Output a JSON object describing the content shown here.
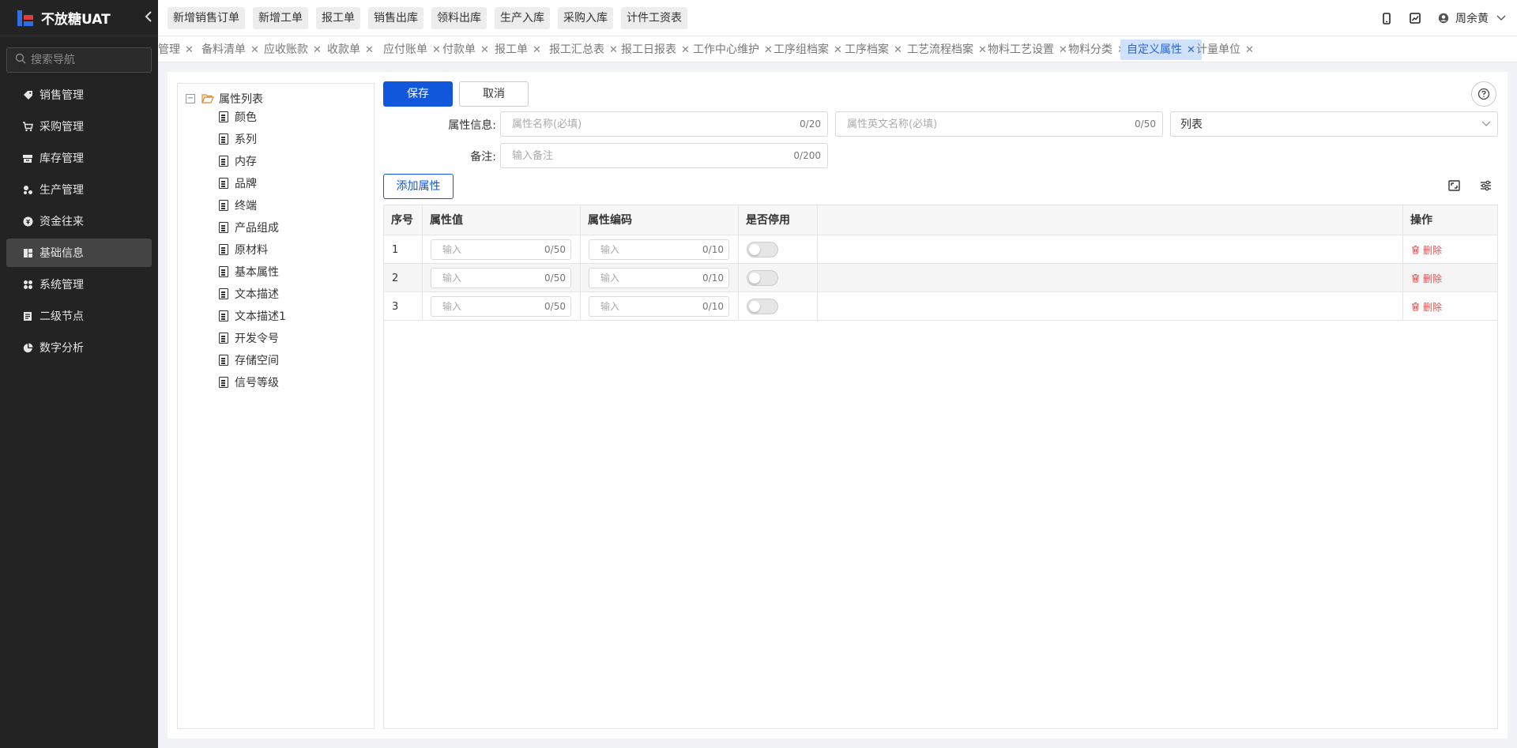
{
  "app": {
    "title": "不放糖UAT"
  },
  "sidebar": {
    "search_placeholder": "搜索导航",
    "items": [
      {
        "label": "销售管理",
        "icon": "tag-icon"
      },
      {
        "label": "采购管理",
        "icon": "cart-icon"
      },
      {
        "label": "库存管理",
        "icon": "warehouse-icon"
      },
      {
        "label": "生产管理",
        "icon": "production-icon"
      },
      {
        "label": "资金往来",
        "icon": "money-icon"
      },
      {
        "label": "基础信息",
        "icon": "basic-info-icon",
        "active": true
      },
      {
        "label": "系统管理",
        "icon": "apps-icon"
      },
      {
        "label": "二级节点",
        "icon": "document-icon"
      },
      {
        "label": "数字分析",
        "icon": "pie-chart-icon"
      }
    ]
  },
  "topbar": {
    "quick_buttons": [
      "新增销售订单",
      "新增工单",
      "报工单",
      "销售出库",
      "领料出库",
      "生产入库",
      "采购入库",
      "计件工资表"
    ],
    "user_name": "周余黄"
  },
  "tabs": [
    {
      "label": "管理"
    },
    {
      "label": "备料清单"
    },
    {
      "label": "应收账款"
    },
    {
      "label": "收款单"
    },
    {
      "label": "应付账单"
    },
    {
      "label": "付款单"
    },
    {
      "label": "报工单"
    },
    {
      "label": "报工汇总表"
    },
    {
      "label": "报工日报表"
    },
    {
      "label": "工作中心维护"
    },
    {
      "label": "工序组档案"
    },
    {
      "label": "工序档案"
    },
    {
      "label": "工艺流程档案"
    },
    {
      "label": "物料工艺设置"
    },
    {
      "label": "物料分类"
    },
    {
      "label": "自定义属性",
      "active": true
    },
    {
      "label": "计量单位"
    }
  ],
  "tree": {
    "root_label": "属性列表",
    "items": [
      "颜色",
      "系列",
      "内存",
      "品牌",
      "终端",
      "产品组成",
      "原材料",
      "基本属性",
      "文本描述",
      "文本描述1",
      "开发令号",
      "存储空间",
      "信号等级"
    ]
  },
  "form": {
    "save_label": "保存",
    "cancel_label": "取消",
    "info_label": "属性信息:",
    "name_placeholder": "属性名称(必填)",
    "name_count": "0/20",
    "en_name_placeholder": "属性英文名称(必填)",
    "en_name_count": "0/50",
    "type_value": "列表",
    "remark_label": "备注:",
    "remark_placeholder": "输入备注",
    "remark_count": "0/200",
    "add_attr_label": "添加属性"
  },
  "table": {
    "headers": [
      "序号",
      "属性值",
      "属性编码",
      "是否停用",
      "",
      "操作"
    ],
    "rows": [
      {
        "index": "1",
        "value_placeholder": "输入",
        "value_count": "0/50",
        "code_placeholder": "输入",
        "code_count": "0/10",
        "disabled": false,
        "action": "删除"
      },
      {
        "index": "2",
        "value_placeholder": "输入",
        "value_count": "0/50",
        "code_placeholder": "输入",
        "code_count": "0/10",
        "disabled": false,
        "action": "删除"
      },
      {
        "index": "3",
        "value_placeholder": "输入",
        "value_count": "0/50",
        "code_placeholder": "输入",
        "code_count": "0/10",
        "disabled": false,
        "action": "删除"
      }
    ]
  },
  "colors": {
    "primary": "#1057db",
    "danger": "#e25050",
    "sidebar_bg": "#232323",
    "active_tab_bg": "#cfe1fb"
  }
}
